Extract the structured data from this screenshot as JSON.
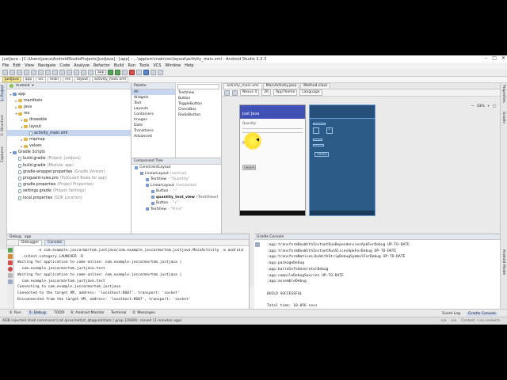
{
  "window": {
    "title": "JustJava - [C:\\Users\\josca\\AndroidStudioProjects\\JustJava] - [app] - ...\\app\\src\\main\\res\\layout\\activity_main.xml - Android Studio 2.3.3"
  },
  "menu": [
    "File",
    "Edit",
    "View",
    "Navigate",
    "Code",
    "Analyze",
    "Refactor",
    "Build",
    "Run",
    "Tools",
    "VCS",
    "Window",
    "Help"
  ],
  "toolbar": {
    "run_config": "app"
  },
  "breadcrumbs": [
    "JustJava",
    "app",
    "src",
    "main",
    "res",
    "layout",
    "activity_main.xml"
  ],
  "project_panel": {
    "view_mode": "Android",
    "tree": [
      {
        "label": "app",
        "hint": ""
      },
      {
        "label": "manifests",
        "hint": ""
      },
      {
        "label": "java",
        "hint": ""
      },
      {
        "label": "res",
        "hint": ""
      },
      {
        "label": "drawable",
        "hint": ""
      },
      {
        "label": "layout",
        "hint": ""
      },
      {
        "label": "activity_main.xml",
        "hint": ""
      },
      {
        "label": "mipmap",
        "hint": ""
      },
      {
        "label": "values",
        "hint": ""
      },
      {
        "label": "Gradle Scripts",
        "hint": ""
      },
      {
        "label": "build.gradle",
        "hint": "(Project: JustJava)"
      },
      {
        "label": "build.gradle",
        "hint": "(Module: app)"
      },
      {
        "label": "gradle-wrapper.properties",
        "hint": "(Gradle Version)"
      },
      {
        "label": "proguard-rules.pro",
        "hint": "(ProGuard Rules for app)"
      },
      {
        "label": "gradle.properties",
        "hint": "(Project Properties)"
      },
      {
        "label": "settings.gradle",
        "hint": "(Project Settings)"
      },
      {
        "label": "local.properties",
        "hint": "(SDK Location)"
      }
    ]
  },
  "side_tabs": {
    "left": [
      "1: Project",
      "2: Structure",
      "Captures",
      "Build Variants",
      "2: Favorites"
    ],
    "right": [
      "Properties",
      "Gradle",
      "Android Model"
    ]
  },
  "palette": {
    "title": "Palette",
    "categories": [
      "All",
      "Widgets",
      "Text",
      "Layouts",
      "Containers",
      "Images",
      "Date",
      "Transitions",
      "Advanced"
    ],
    "items": [
      "TextView",
      "Button",
      "ToggleButton",
      "CheckBox",
      "RadioButton"
    ]
  },
  "component_tree": {
    "title": "Component Tree",
    "nodes": [
      {
        "label": "ConstraintLayout",
        "hint": ""
      },
      {
        "label": "LinearLayout",
        "hint": "(vertical)"
      },
      {
        "label": "TextView",
        "hint": "- \"Quantity\""
      },
      {
        "label": "LinearLayout",
        "hint": "(horizontal)"
      },
      {
        "label": "Button",
        "hint": "- \"-\""
      },
      {
        "label": "quantity_text_view",
        "hint": "(TextView)"
      },
      {
        "label": "Button",
        "hint": "- \"+\""
      },
      {
        "label": "TextView",
        "hint": "- \"Price\""
      }
    ]
  },
  "design_tabs": [
    "Design",
    "Text"
  ],
  "editor": {
    "tabs": [
      "activity_main.xml",
      "MainActivity.java",
      "Method.class"
    ],
    "toolbar": [
      "Nexus 4",
      "26",
      "AppTheme",
      "Language"
    ],
    "zoom": "33%",
    "preview": {
      "app_title": "Just Java",
      "quantity_label": "Quantity",
      "price_label": "Price",
      "order_button": "ORDER"
    },
    "blueprint": {
      "minus": "-",
      "plus": "+",
      "order": "ORDER"
    }
  },
  "debug_panel": {
    "title": "Debug",
    "config": "app",
    "tabs": [
      "Debugger",
      "Console"
    ],
    "lines": [
      "         -n com.example.joscarmartom.justjava/com.example.joscarmartom.justjava.MainActivity -a android",
      "  .intent.category.LAUNCHER -D",
      "Waiting for application to come online: com.example.joscarmartom.justjava |",
      "  com.example.joscarmartom.justjava.test",
      "Waiting for application to come online: com.example.joscarmartom.justjava |",
      "  com.example.joscarmartom.justjava.test",
      "Connecting to com.example.joscarmartom.justjava",
      "Connected to the target VM, address: 'localhost:8607', transport: 'socket'",
      "Disconnected from the target VM, address: 'localhost:8607', transport: 'socket'"
    ]
  },
  "gradle_console": {
    "title": "Gradle Console",
    "lines": [
      ":app:transformDexWithInstantRunDependenciesApkForDebug UP-TO-DATE",
      ":app:transformDexWithInstantRunSlicesApkForDebug UP-TO-DATE",
      ":app:transformNativeLibsWithStripDebugSymbolForDebug UP-TO-DATE",
      ":app:packageDebug",
      ":app:buildInfoGeneratorDebug",
      ":app:compileDebugSources UP-TO-DATE",
      ":app:assembleDebug",
      "",
      "BUILD SUCCESSFUL",
      "",
      "Total time: 10.056 secs"
    ]
  },
  "bottom_tabs": [
    "4: Run",
    "5: Debug",
    "TODO",
    "6: Android Monitor",
    "Terminal",
    "0: Messages"
  ],
  "bottom_tabs_right": [
    "Event Log",
    "Gradle Console"
  ],
  "status": {
    "message": "ADB rejected shell command (cat /proc/net/xt_qtaguid/stats | grep 10089): closed (3 minutes ago)",
    "right": [
      "n/a",
      "n/a",
      "Context: <no context>"
    ]
  },
  "colors": {
    "appbar": "#3f51b5",
    "blueprint": "#2b5b86",
    "highlight": "#ffe02e"
  }
}
